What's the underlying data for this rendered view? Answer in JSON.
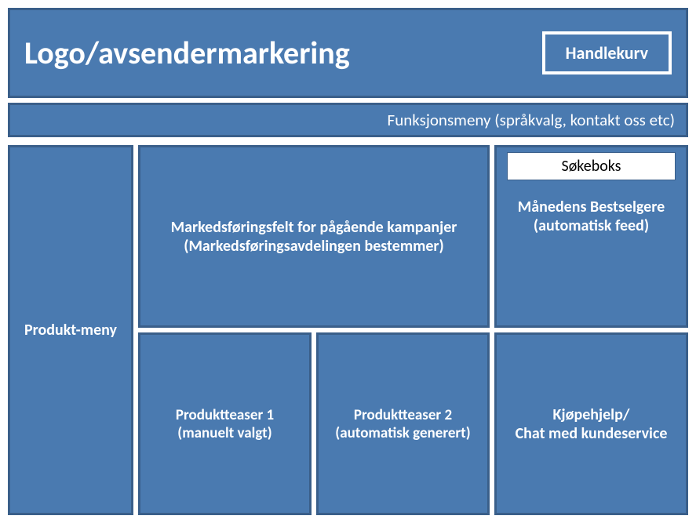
{
  "header": {
    "logo": "Logo/avsendermarkering",
    "cart": "Handlekurv"
  },
  "function_menu": "Funksjonsmeny (språkvalg, kontakt oss etc)",
  "product_menu": "Produkt-meny",
  "marketing": "Markedsføringsfelt for pågående kampanjer (Markedsføringsavdelingen bestemmer)",
  "search": "Søkeboks",
  "bestsellers": "Månedens Bestselgere (automatisk feed)",
  "teaser1": "Produktteaser 1\n(manuelt valgt)",
  "teaser2": "Produktteaser 2\n(automatisk generert)",
  "chat": "Kjøpehjelp/\nChat med kundeservice"
}
